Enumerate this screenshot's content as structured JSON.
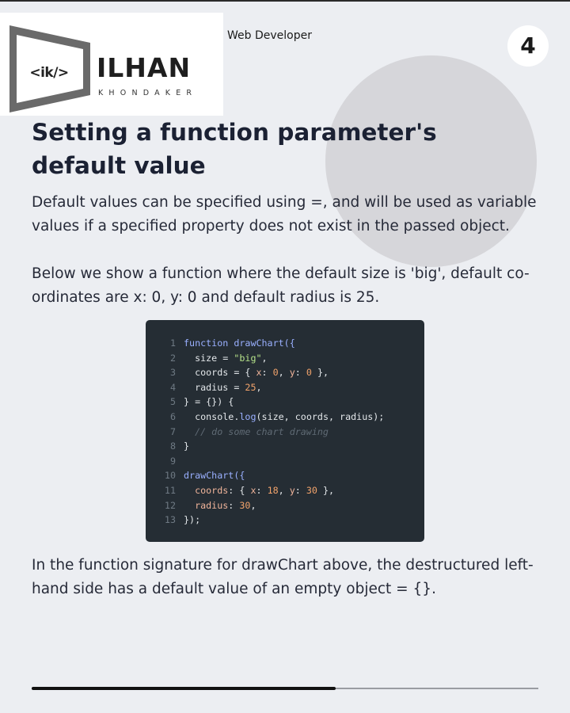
{
  "header": {
    "logo_code": "<ik/>",
    "logo_name": "ILHAN",
    "logo_surname": "KHONDAKER",
    "role": "Web Developer",
    "page_number": "4"
  },
  "title": "Setting a function parameter's default value",
  "paragraphs": {
    "p1": "Default values can be specified using =, and will be used as variable values if a specified property does not exist in the passed object.",
    "p2": "Below we show a function where the default size is 'big', default co-ordinates are x: 0, y: 0 and default radius is 25.",
    "p3": "In the function signature for drawChart above, the destructured left-hand side has a default value of an empty object = {}."
  },
  "code": {
    "lines": [
      {
        "n": "1",
        "tokens": [
          {
            "t": "function drawChart({",
            "c": "kw"
          }
        ]
      },
      {
        "n": "2",
        "tokens": [
          {
            "t": "  size = ",
            "c": ""
          },
          {
            "t": "\"big\"",
            "c": "str"
          },
          {
            "t": ",",
            "c": ""
          }
        ]
      },
      {
        "n": "3",
        "tokens": [
          {
            "t": "  coords = { ",
            "c": ""
          },
          {
            "t": "x",
            "c": "prop"
          },
          {
            "t": ": ",
            "c": ""
          },
          {
            "t": "0",
            "c": "num"
          },
          {
            "t": ", ",
            "c": ""
          },
          {
            "t": "y",
            "c": "prop"
          },
          {
            "t": ": ",
            "c": ""
          },
          {
            "t": "0",
            "c": "num"
          },
          {
            "t": " },",
            "c": ""
          }
        ]
      },
      {
        "n": "4",
        "tokens": [
          {
            "t": "  radius = ",
            "c": ""
          },
          {
            "t": "25",
            "c": "num"
          },
          {
            "t": ",",
            "c": ""
          }
        ]
      },
      {
        "n": "5",
        "tokens": [
          {
            "t": "} = {}) {",
            "c": ""
          }
        ]
      },
      {
        "n": "6",
        "tokens": [
          {
            "t": "  console.",
            "c": ""
          },
          {
            "t": "log",
            "c": "kw"
          },
          {
            "t": "(size, coords, radius);",
            "c": ""
          }
        ]
      },
      {
        "n": "7",
        "tokens": [
          {
            "t": "  // do some chart drawing",
            "c": "cmt"
          }
        ]
      },
      {
        "n": "8",
        "tokens": [
          {
            "t": "}",
            "c": ""
          }
        ]
      },
      {
        "n": "9",
        "tokens": [
          {
            "t": "",
            "c": ""
          }
        ]
      },
      {
        "n": "10",
        "tokens": [
          {
            "t": "drawChart({",
            "c": "kw"
          }
        ]
      },
      {
        "n": "11",
        "tokens": [
          {
            "t": "  coords",
            "c": "prop"
          },
          {
            "t": ": { ",
            "c": ""
          },
          {
            "t": "x",
            "c": "prop"
          },
          {
            "t": ": ",
            "c": ""
          },
          {
            "t": "18",
            "c": "num"
          },
          {
            "t": ", ",
            "c": ""
          },
          {
            "t": "y",
            "c": "prop"
          },
          {
            "t": ": ",
            "c": ""
          },
          {
            "t": "30",
            "c": "num"
          },
          {
            "t": " },",
            "c": ""
          }
        ]
      },
      {
        "n": "12",
        "tokens": [
          {
            "t": "  radius",
            "c": "prop"
          },
          {
            "t": ": ",
            "c": ""
          },
          {
            "t": "30",
            "c": "num"
          },
          {
            "t": ",",
            "c": ""
          }
        ]
      },
      {
        "n": "13",
        "tokens": [
          {
            "t": "});",
            "c": ""
          }
        ]
      }
    ]
  },
  "progress": {
    "fraction": 0.6
  },
  "colors": {
    "background": "#eceef2",
    "title": "#1b2133",
    "code_bg": "#252d34",
    "keyword": "#9ab0ff",
    "string": "#b6e38a",
    "number": "#f2a36b"
  }
}
